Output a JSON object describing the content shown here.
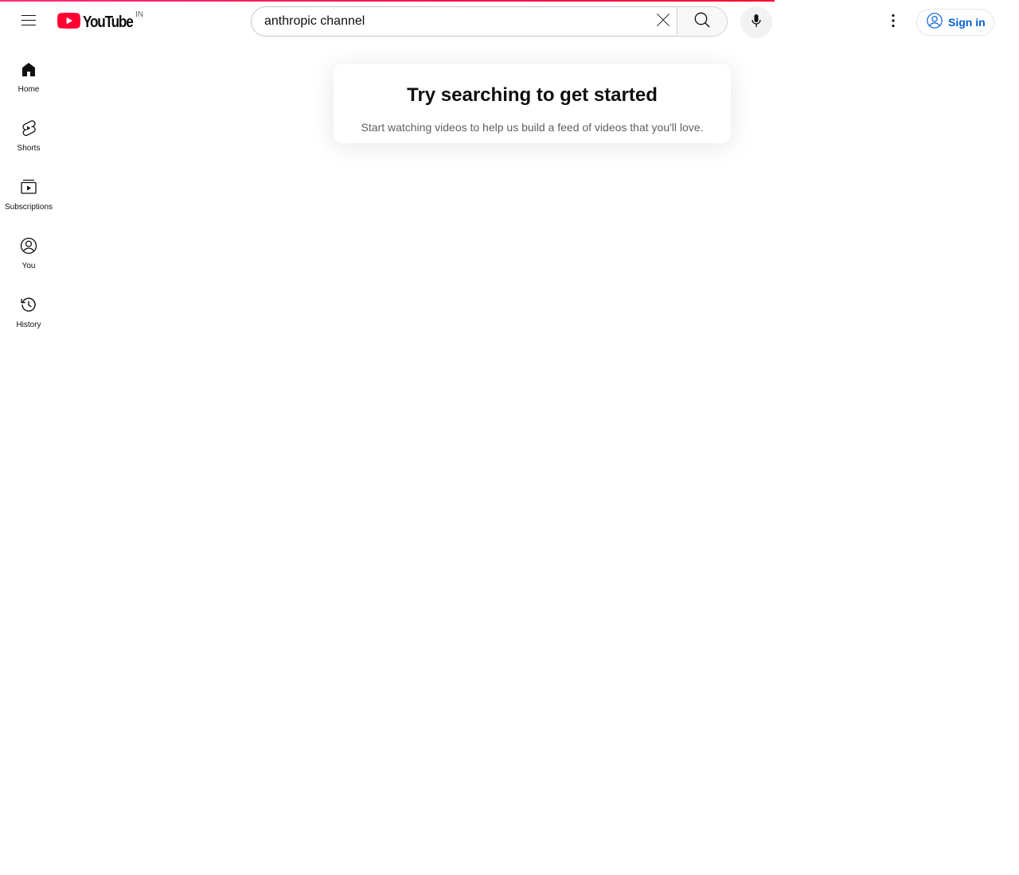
{
  "app": {
    "brand": "YouTube",
    "country_code": "IN",
    "page_progress_percent": 76
  },
  "header": {
    "menu_icon": "hamburger-menu-icon",
    "search": {
      "value": "anthropic channel",
      "clear_icon": "close-icon",
      "button_icon": "search-icon"
    },
    "voice_icon": "microphone-icon",
    "more_icon": "vertical-dots-icon",
    "signin": {
      "label": "Sign in",
      "icon": "account-circle-icon"
    }
  },
  "sidebar": {
    "items": [
      {
        "label": "Home",
        "icon": "home-icon"
      },
      {
        "label": "Shorts",
        "icon": "shorts-icon"
      },
      {
        "label": "Subscriptions",
        "icon": "subscriptions-icon"
      },
      {
        "label": "You",
        "icon": "account-circle-icon"
      },
      {
        "label": "History",
        "icon": "history-icon"
      }
    ]
  },
  "main": {
    "empty_state": {
      "title": "Try searching to get started",
      "subtitle": "Start watching videos to help us build a feed of videos that you'll love."
    }
  },
  "colors": {
    "brand_red": "#ff0033",
    "link_blue": "#065fd4",
    "text_primary": "#0f0f0f",
    "text_secondary": "#606060"
  }
}
